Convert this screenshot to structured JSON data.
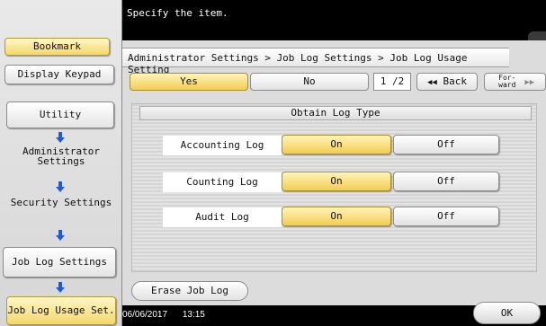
{
  "message": "Specify the item.",
  "left_panel": {
    "bookmark": "Bookmark",
    "display_keypad": "Display Keypad",
    "utility": "Utility",
    "administrator_settings": "Administrator Settings",
    "security_settings": "Security Settings",
    "job_log_settings": "Job Log Settings",
    "job_log_usage_set": "Job Log Usage Set."
  },
  "breadcrumb": "Administrator Settings > Job Log Settings > Job Log Usage Setting",
  "tabs": {
    "yes": "Yes",
    "no": "No"
  },
  "pagination": {
    "page": "1 /2",
    "back": "Back",
    "forward": "For- ward"
  },
  "section_title": "Obtain Log Type",
  "rows": [
    {
      "label": "Accounting Log",
      "on": "On",
      "off": "Off",
      "selected": "On"
    },
    {
      "label": "Counting Log",
      "on": "On",
      "off": "Off",
      "selected": "On"
    },
    {
      "label": "Audit Log",
      "on": "On",
      "off": "Off",
      "selected": "On"
    }
  ],
  "erase_button": "Erase Job Log",
  "ok_button": "OK",
  "date": "06/06/2017",
  "time": "13:15",
  "colors": {
    "accent": "#f2cc55",
    "panel": "#dcdcdc",
    "arrow": "#1e5bd8"
  }
}
